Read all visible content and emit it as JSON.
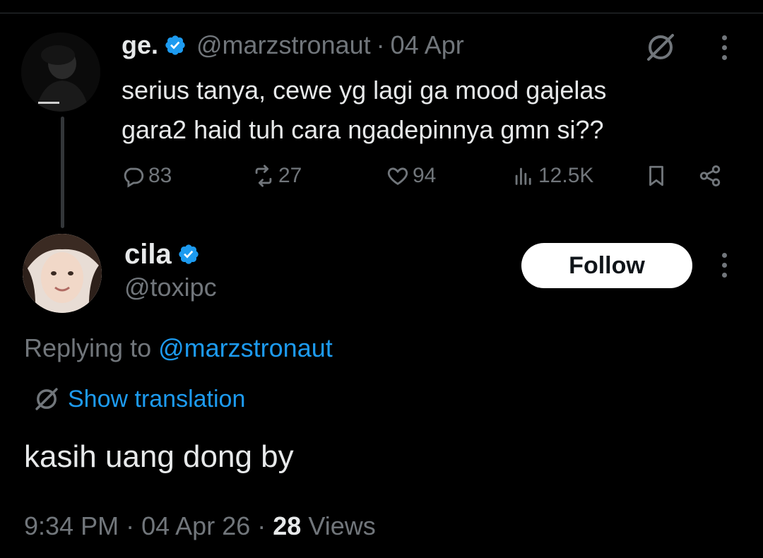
{
  "parent_tweet": {
    "name": "ge.",
    "handle": "@marzstronaut",
    "separator": "·",
    "date": "04 Apr",
    "text_line1": "serius tanya, cewe yg lagi ga mood gajelas",
    "text_line2": "gara2 haid tuh cara ngadepinnya gmn si??",
    "replies": "83",
    "reposts": "27",
    "likes": "94",
    "views": "12.5K"
  },
  "reply_tweet": {
    "name": "cila",
    "handle": "@toxipc",
    "follow_label": "Follow",
    "replying_prefix": "Replying to",
    "replying_handle": "@marzstronaut",
    "show_translation": "Show translation",
    "text": "kasih uang dong by",
    "time": "9:34 PM",
    "separator": "·",
    "date": "04 Apr 26",
    "views_count": "28",
    "views_label": "Views"
  },
  "colors": {
    "background": "#000000",
    "text": "#e7e9ea",
    "muted": "#71767b",
    "link": "#1d9bf0",
    "verified": "#1d9bf0"
  },
  "icons": [
    "verified-badge-icon",
    "grok-translate-icon",
    "more-options-icon",
    "reply-icon",
    "repost-icon",
    "like-icon",
    "views-icon",
    "bookmark-icon",
    "share-icon"
  ]
}
